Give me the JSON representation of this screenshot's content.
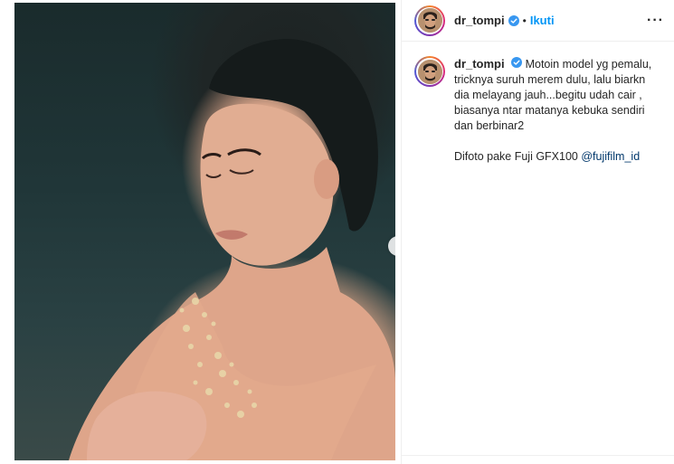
{
  "post": {
    "photo_alt": "Woman in peach dress with eyes closed holding dried baby's breath flowers",
    "next_icon": "chevron-right-icon"
  },
  "header": {
    "username": "dr_tompi",
    "separator": "•",
    "follow_label": "Ikuti",
    "more_label": "···",
    "verified_color": "#3897f0",
    "follow_color": "#0095f6"
  },
  "caption": {
    "username": "dr_tompi",
    "lines": [
      "Motoin model yg pemalu,",
      "tricknya suruh merem dulu, lalu biarkn",
      "dia melayang jauh...begitu udah cair ,",
      "biasanya ntar matanya kebuka sendiri",
      "dan berbinar2"
    ],
    "second_paragraph_text": "Difoto pake Fuji GFX100 ",
    "mention": "@fujifilm_id"
  }
}
